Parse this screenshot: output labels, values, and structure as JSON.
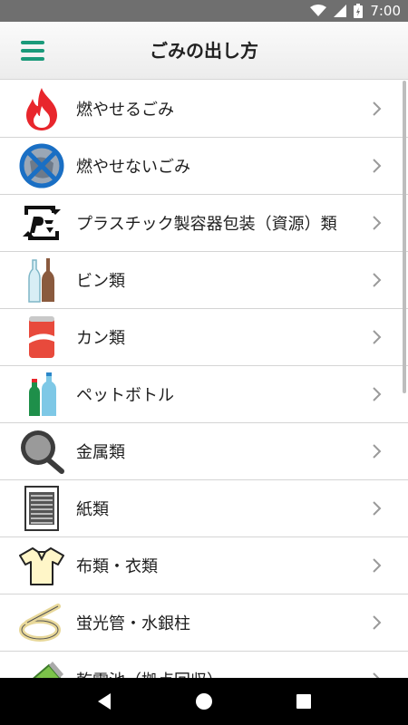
{
  "status_bar": {
    "time": "7:00",
    "battery_icon": "battery-charging-icon",
    "wifi_icon": "wifi-icon",
    "signal_icon": "signal-icon"
  },
  "app_bar": {
    "title": "ごみの出し方",
    "menu_icon": "hamburger-menu-icon",
    "accent": "#1a9a7a"
  },
  "items": [
    {
      "label": "燃やせるごみ",
      "icon": "burnable-trash-flame-icon"
    },
    {
      "label": "燃やせないごみ",
      "icon": "non-burnable-trash-icon"
    },
    {
      "label": "プラスチック製容器包装（資源）類",
      "icon": "plastic-recycle-mark-icon"
    },
    {
      "label": "ビン類",
      "icon": "glass-bottles-icon"
    },
    {
      "label": "カン類",
      "icon": "can-icon"
    },
    {
      "label": "ペットボトル",
      "icon": "pet-bottles-icon"
    },
    {
      "label": "金属類",
      "icon": "frying-pan-icon"
    },
    {
      "label": "紙類",
      "icon": "paper-stack-icon"
    },
    {
      "label": "布類・衣類",
      "icon": "clothing-shirt-icon"
    },
    {
      "label": "蛍光管・水銀柱",
      "icon": "fluorescent-tube-icon"
    },
    {
      "label": "乾電池（拠点回収）",
      "icon": "battery-icon"
    }
  ],
  "nav_bar": {
    "back": "back-icon",
    "home": "home-icon",
    "recents": "recents-icon"
  }
}
